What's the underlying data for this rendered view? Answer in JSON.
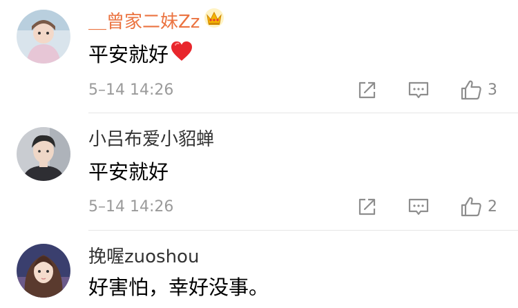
{
  "comments": [
    {
      "username": "＿曾家二妹Zz",
      "text": "平安就好",
      "time": "5–14 14:26",
      "likes": "3",
      "vip": true,
      "has_heart_emoji": true,
      "username_color": "#eb7340"
    },
    {
      "username": "小吕布爱小貂蝉",
      "text": "平安就好",
      "time": "5–14 14:26",
      "likes": "2",
      "vip": false
    },
    {
      "username": "挽喔zuoshou",
      "text": "好害怕，幸好没事。",
      "vip": false
    }
  ],
  "icons": {
    "repost": "repost-icon",
    "reply": "comment-icon",
    "like": "thumbs-up-icon",
    "vip": "crown-icon",
    "emoji": "red-heart-icon"
  },
  "colors": {
    "vip_name": "#eb7340",
    "heart": "#e8262c",
    "crown": "#f4b400",
    "meta": "#9a9a9a"
  }
}
